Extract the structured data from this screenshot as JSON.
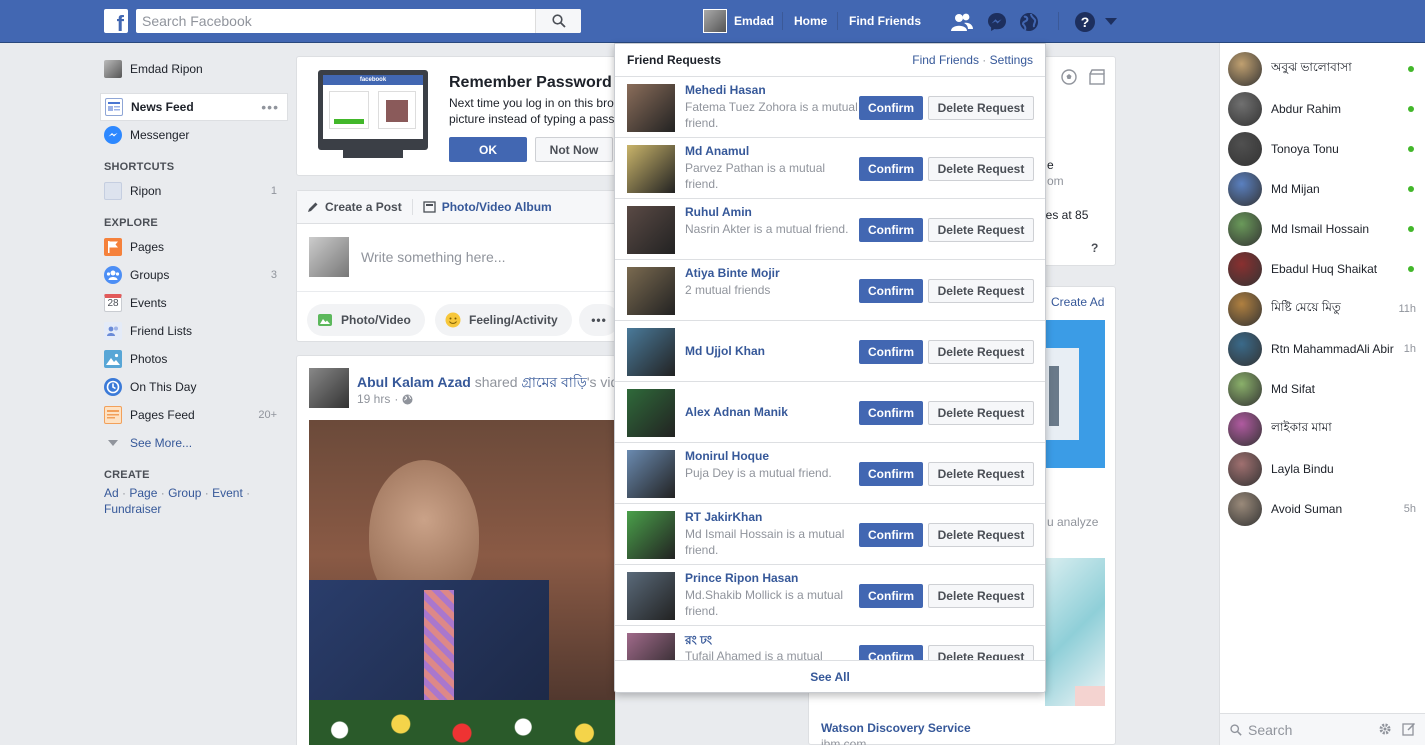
{
  "topbar": {
    "search_placeholder": "Search Facebook",
    "user_name": "Emdad",
    "home": "Home",
    "find_friends": "Find Friends"
  },
  "left": {
    "profile_name": "Emdad Ripon",
    "news_feed": "News Feed",
    "messenger": "Messenger",
    "shortcuts_head": "SHORTCUTS",
    "shortcut_item": "Ripon",
    "shortcut_count": "1",
    "explore_head": "EXPLORE",
    "explore": [
      {
        "label": "Pages",
        "count": "",
        "icon": "flag-icon",
        "color": "#f5813b"
      },
      {
        "label": "Groups",
        "count": "3",
        "icon": "groups-icon",
        "color": "#4c8ef5"
      },
      {
        "label": "Events",
        "count": "",
        "icon": "calendar-icon",
        "color": "#e25a5a"
      },
      {
        "label": "Friend Lists",
        "count": "",
        "icon": "friend-lists-icon",
        "color": "#6a8bd8"
      },
      {
        "label": "Photos",
        "count": "",
        "icon": "photos-icon",
        "color": "#58a6d6"
      },
      {
        "label": "On This Day",
        "count": "",
        "icon": "clock-icon",
        "color": "#3b7ad8"
      },
      {
        "label": "Pages Feed",
        "count": "20+",
        "icon": "pages-feed-icon",
        "color": "#f2a05a"
      }
    ],
    "calendar_day": "28",
    "see_more": "See More...",
    "create_head": "CREATE",
    "create_links": [
      "Ad",
      "Page",
      "Group",
      "Event",
      "Fundraiser"
    ]
  },
  "reminder": {
    "title": "Remember Password",
    "body_line1": "Next time you log in on this bro",
    "body_line2": "picture instead of typing a pass",
    "ok": "OK",
    "not_now": "Not Now",
    "preview_logo": "facebook"
  },
  "composer": {
    "tab_post": "Create a Post",
    "tab_album": "Photo/Video Album",
    "placeholder": "Write something here...",
    "photo_video": "Photo/Video",
    "feeling": "Feeling/Activity"
  },
  "post": {
    "author": "Abul Kalam Azad",
    "shared": "shared",
    "shared_title": "গ্রামের বাড়ি",
    "shared_suffix": "'s vide",
    "time": "19 hrs"
  },
  "right_col": {
    "text_e": "e",
    "text_om": "om",
    "text_ies": "ies at 85",
    "help": "?",
    "create_ad": "Create Ad",
    "analyze": "u analyze",
    "watson": "Watson Discovery Service",
    "ibm": "ibm.com"
  },
  "friend_requests": {
    "title": "Friend Requests",
    "find_friends": "Find Friends",
    "settings": "Settings",
    "confirm": "Confirm",
    "delete": "Delete Request",
    "see_all": "See All",
    "items": [
      {
        "name": "Mehedi Hasan",
        "mutual": "Fatema Tuez Zohora is a mutual friend.",
        "color": "#8a6d5a"
      },
      {
        "name": "Md Anamul",
        "mutual": "Parvez Pathan is a mutual friend.",
        "color": "#c9b46a"
      },
      {
        "name": "Ruhul Amin",
        "mutual": "Nasrin Akter is a mutual friend.",
        "color": "#5a4a45"
      },
      {
        "name": "Atiya Binte Mojir",
        "mutual": "2 mutual friends",
        "color": "#7a6a50"
      },
      {
        "name": "Md Ujjol Khan",
        "mutual": "",
        "color": "#4a7a9a"
      },
      {
        "name": "Alex Adnan Manik",
        "mutual": "",
        "color": "#2f6a3a"
      },
      {
        "name": "Monirul Hoque",
        "mutual": "Puja Dey is a mutual friend.",
        "color": "#6a8ab0"
      },
      {
        "name": "RT JakirKhan",
        "mutual": "Md Ismail Hossain is a mutual friend.",
        "color": "#4aa04a"
      },
      {
        "name": "Prince Ripon Hasan",
        "mutual": "Md.Shakib Mollick is a mutual friend.",
        "color": "#5a6a7a"
      },
      {
        "name": "রং ঢং",
        "mutual": "Tufail Ahamed is a mutual",
        "color": "#a06a8a"
      }
    ]
  },
  "chat": {
    "search_placeholder": "Search",
    "contacts": [
      {
        "name": "অবুঝ ভালোবাসা",
        "status": "online",
        "time": "",
        "color": "#c0a070"
      },
      {
        "name": "Abdur Rahim",
        "status": "online",
        "time": "",
        "color": "#707070"
      },
      {
        "name": "Tonoya Tonu",
        "status": "online",
        "time": "",
        "color": "#505050"
      },
      {
        "name": "Md Mijan",
        "status": "online",
        "time": "",
        "color": "#5a80c0"
      },
      {
        "name": "Md Ismail Hossain",
        "status": "online",
        "time": "",
        "color": "#6a9a5a"
      },
      {
        "name": "Ebadul Huq Shaikat",
        "status": "online",
        "time": "",
        "color": "#8a3030"
      },
      {
        "name": "মিষ্টি মেয়ে মিতু",
        "status": "idle",
        "time": "11h",
        "color": "#b08040"
      },
      {
        "name": "Rtn MahammadAli Abir",
        "status": "idle",
        "time": "1h",
        "color": "#3a6a8a"
      },
      {
        "name": "Md Sifat",
        "status": "none",
        "time": "",
        "color": "#8ab06a"
      },
      {
        "name": "লাইকার মামা",
        "status": "none",
        "time": "",
        "color": "#b05aa0"
      },
      {
        "name": "Layla Bindu",
        "status": "none",
        "time": "",
        "color": "#a07070"
      },
      {
        "name": "Avoid Suman",
        "status": "idle",
        "time": "5h",
        "color": "#9a8a7a"
      }
    ]
  }
}
